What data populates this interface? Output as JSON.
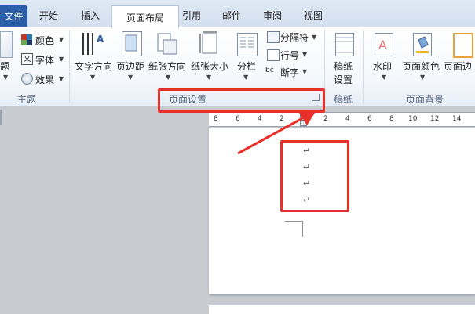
{
  "tabs": {
    "file": "文件",
    "home": "开始",
    "insert": "插入",
    "page_layout": "页面布局",
    "references": "引用",
    "mailings": "邮件",
    "review": "审阅",
    "view": "视图"
  },
  "theme_group": {
    "themes_label": "题",
    "colors": "颜色",
    "fonts": "字体",
    "effects": "效果",
    "group_label": "主题",
    "font_icon_glyph": "文"
  },
  "page_setup_group": {
    "text_direction": "文字方向",
    "margins": "页边距",
    "orientation": "纸张方向",
    "size": "纸张大小",
    "columns": "分栏",
    "breaks": "分隔符",
    "line_numbers": "行号",
    "hyphenation": "断字",
    "group_label": "页面设置",
    "text_direction_glyph": "A",
    "hyphenation_glyph": "bc"
  },
  "manuscript_group": {
    "settings_line1": "稿纸",
    "settings_line2": "设置",
    "group_label": "稿纸"
  },
  "page_background_group": {
    "watermark": "水印",
    "page_color": "页面颜色",
    "page_borders": "页面边",
    "group_label": "页面背景",
    "watermark_glyph": "A"
  },
  "ruler": {
    "ticks": [
      "8",
      "6",
      "4",
      "2",
      "2",
      "4",
      "6",
      "8",
      "10",
      "12",
      "14"
    ]
  },
  "document": {
    "paragraph_mark": "↵"
  },
  "annotation_color": "#e8302a",
  "accent_color": "#2a5ea8"
}
